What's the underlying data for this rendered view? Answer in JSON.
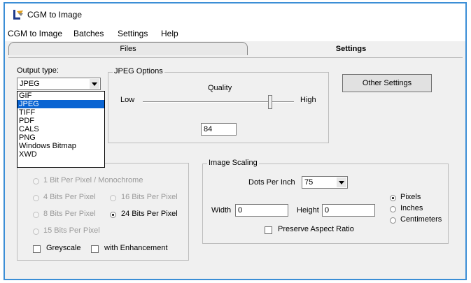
{
  "window": {
    "title": "CGM to Image"
  },
  "menu": [
    "CGM to Image",
    "Batches",
    "Settings",
    "Help"
  ],
  "tabs": {
    "files": "Files",
    "settings": "Settings"
  },
  "output_type": {
    "label": "Output type:",
    "selected": "JPEG",
    "options": [
      "GIF",
      "JPEG",
      "TIFF",
      "PDF",
      "CALS",
      "PNG",
      "Windows Bitmap",
      "XWD"
    ]
  },
  "jpeg_options": {
    "title": "JPEG Options",
    "quality_label": "Quality",
    "low": "Low",
    "high": "High",
    "value": "84"
  },
  "other_settings": "Other Settings",
  "color_depth": {
    "r1": "1 Bit Per Pixel / Monochrome",
    "r4": "4 Bits Per Pixel",
    "r16": "16 Bits Per Pixel",
    "r8": "8 Bits Per Pixel",
    "r24": "24 Bits Per Pixel",
    "r15": "15 Bits Per Pixel",
    "greyscale": "Greyscale",
    "enhancement": "with Enhancement"
  },
  "image_scaling": {
    "title": "Image Scaling",
    "dpi_label": "Dots Per Inch",
    "dpi_value": "75",
    "width_label": "Width",
    "width_value": "0",
    "height_label": "Height",
    "height_value": "0",
    "units": [
      "Pixels",
      "Inches",
      "Centimeters"
    ],
    "preserve": "Preserve Aspect Ratio"
  }
}
